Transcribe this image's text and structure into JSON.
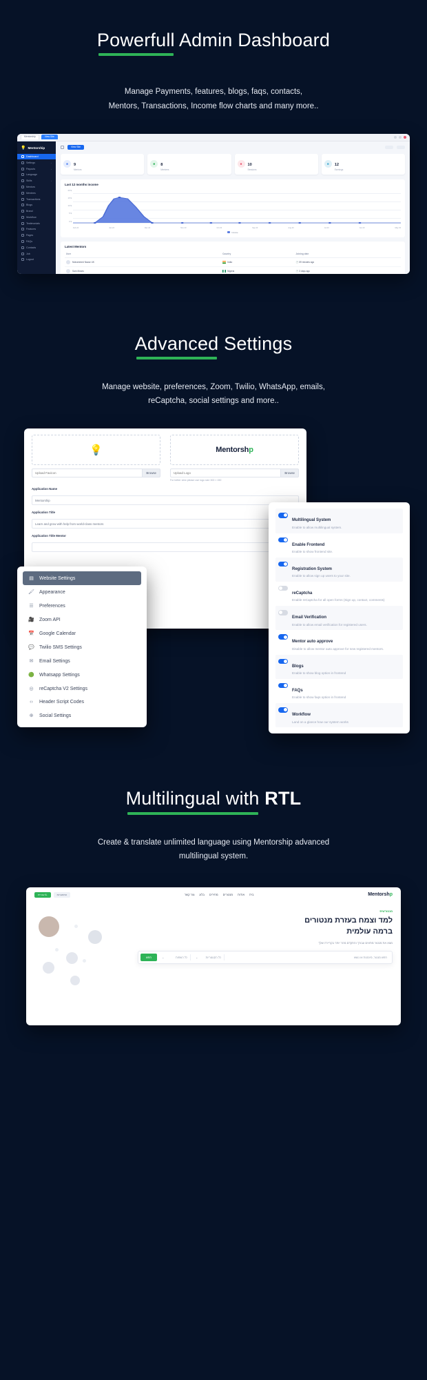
{
  "sections": [
    {
      "heading_underlined": "Powerfull",
      "heading_rest": " Admin Dashboard",
      "sub_line1": "Manage Payments, features, blogs, faqs, contacts,",
      "sub_line2": "Mentors, Transactions, Income flow charts and many more.."
    },
    {
      "heading_underlined": "Advanced",
      "heading_rest": " Settings",
      "sub_line1": "Manage website, preferences, Zoom, Twilio, WhatsApp, emails,",
      "sub_line2": "reCaptcha, social settings and more.."
    },
    {
      "heading_underlined": "Multilingual with",
      "heading_rest": " RTL",
      "sub_line1": "Create & translate unlimited language using Mentorship advanced",
      "sub_line2": "multilingual system."
    }
  ],
  "colors": {
    "background": "#061227",
    "accent_green": "#2eb357",
    "accent_blue": "#1767ef",
    "sidebar": "#0f1a33"
  },
  "dashboard": {
    "browser": {
      "tab_label": "Mentorship",
      "tab_label_active": "View Site"
    },
    "brand": "Mentorship",
    "brand_icon": "bulb-icon",
    "nav": [
      {
        "label": "Dashboard",
        "icon": "grid-icon",
        "active": true,
        "caret": ""
      },
      {
        "label": "Settings",
        "icon": "gear-icon",
        "active": false,
        "caret": "‹"
      },
      {
        "label": "Payouts",
        "icon": "wallet-icon",
        "active": false,
        "caret": "‹"
      },
      {
        "label": "Language",
        "icon": "globe-icon",
        "active": false,
        "caret": ""
      },
      {
        "label": "Skills",
        "icon": "star-icon",
        "active": false,
        "caret": "‹"
      },
      {
        "label": "Mentors",
        "icon": "users-icon",
        "active": false,
        "caret": ""
      },
      {
        "label": "Mentees",
        "icon": "user-icon",
        "active": false,
        "caret": ""
      },
      {
        "label": "Transactions",
        "icon": "exchange-icon",
        "active": false,
        "caret": ""
      },
      {
        "label": "Blogs",
        "icon": "article-icon",
        "active": false,
        "caret": ""
      },
      {
        "label": "Brand",
        "icon": "tag-icon",
        "active": false,
        "caret": ""
      },
      {
        "label": "Workflow",
        "icon": "flow-icon",
        "active": false,
        "caret": ""
      },
      {
        "label": "Testimonials",
        "icon": "quote-icon",
        "active": false,
        "caret": ""
      },
      {
        "label": "Features",
        "icon": "list-icon",
        "active": false,
        "caret": ""
      },
      {
        "label": "Pages",
        "icon": "page-icon",
        "active": false,
        "caret": ""
      },
      {
        "label": "FAQs",
        "icon": "question-icon",
        "active": false,
        "caret": ""
      },
      {
        "label": "Contacts",
        "icon": "mail-icon",
        "active": false,
        "caret": ""
      },
      {
        "label": "Job",
        "icon": "briefcase-icon",
        "active": false,
        "caret": ""
      },
      {
        "label": "Logout",
        "icon": "logout-icon",
        "active": false,
        "caret": ""
      }
    ],
    "view_site_button": "View Site",
    "stats": [
      {
        "number": "9",
        "label": "Mentors",
        "icon": "users-icon",
        "color": "#e6edfd",
        "fg": "#4d7ef0"
      },
      {
        "number": "8",
        "label": "Mentees",
        "icon": "badge-icon",
        "color": "#e3f6ea",
        "fg": "#2eb357"
      },
      {
        "number": "10",
        "label": "Sessions",
        "icon": "calendar-icon",
        "color": "#fde7ea",
        "fg": "#e8576f"
      },
      {
        "number": "12",
        "label": "Earnings",
        "icon": "wallet-icon",
        "color": "#def0f7",
        "fg": "#3fa8cf"
      }
    ],
    "chart": {
      "title": "Last 12 months income",
      "legend": "Income"
    },
    "table": {
      "title": "Latest Mentors",
      "columns": [
        "User",
        "Country",
        "Joining date"
      ],
      "rows": [
        {
          "user": "Muhammed Navaz UK",
          "country": "India",
          "flag": "in",
          "joined": "59 minutes ago"
        },
        {
          "user": "Sam Moses",
          "country": "Nigeria",
          "flag": "ng",
          "joined": "3 days ago"
        }
      ]
    }
  },
  "chart_data": {
    "type": "area",
    "title": "Last 12 months income",
    "xlabel": "",
    "ylabel": "",
    "grid": true,
    "legend_position": "bottom",
    "series": [
      {
        "name": "Income",
        "color": "#5b7ce0",
        "values": [
          0,
          18,
          0,
          0,
          0,
          0,
          0,
          0,
          0,
          0,
          0,
          0
        ]
      }
    ],
    "categories": [
      "Feb 24",
      "Jan 24",
      "Dec 24",
      "Nov 23",
      "Oct 23",
      "Sep 23",
      "Aug 23",
      "Jul 23",
      "Jun 23",
      "May 23",
      "Apr 23",
      "Mar 23"
    ],
    "ytick_labels": [
      "20 $",
      "15 $",
      "10 $",
      "5 $",
      "0 $"
    ],
    "ylim": [
      0,
      20
    ]
  },
  "settings": {
    "favicon": {
      "drop_icon": "bulb-icon",
      "upload_placeholder": "Upload Favicon",
      "browse_label": "Browse"
    },
    "logo": {
      "brand_text": "Mentorsh",
      "brand_text_accent": "p",
      "upload_placeholder": "Upload Logo",
      "browse_label": "Browse",
      "hint": "For better view please use logo size 300 × 150"
    },
    "fields": [
      {
        "label": "Application Name",
        "value": "Mentorship"
      },
      {
        "label": "Application Title",
        "value": "Learn and grow with help from world-class mentors"
      },
      {
        "label": "Application Title Mentor",
        "value": ""
      }
    ],
    "menu": [
      {
        "label": "Website Settings",
        "icon": "layout-icon",
        "active": true
      },
      {
        "label": "Appearance",
        "icon": "brush-icon",
        "active": false
      },
      {
        "label": "Preferences",
        "icon": "sliders-icon",
        "active": false
      },
      {
        "label": "Zoom API",
        "icon": "video-icon",
        "active": false
      },
      {
        "label": "Google Calendar",
        "icon": "calendar-icon",
        "active": false
      },
      {
        "label": "Twilio SMS Settings",
        "icon": "chat-icon",
        "active": false
      },
      {
        "label": "Email Settings",
        "icon": "mail-icon",
        "active": false
      },
      {
        "label": "Whatsapp Settings",
        "icon": "whatsapp-icon",
        "active": false
      },
      {
        "label": "reCaptcha V2 Settings",
        "icon": "shield-icon",
        "active": false
      },
      {
        "label": "Header Script Codes",
        "icon": "code-icon",
        "active": false
      },
      {
        "label": "Social Settings",
        "icon": "share-icon",
        "active": false
      }
    ],
    "toggles": [
      {
        "title": "Multilingual System",
        "desc": "Enable to allow multilingual system.",
        "on": true
      },
      {
        "title": "Enable Frontend",
        "desc": "Enable to show frontend site.",
        "on": true
      },
      {
        "title": "Registration System",
        "desc": "Enable to allow sign up users to your site.",
        "on": true
      },
      {
        "title": "reCaptcha",
        "desc": "Enable reCaptcha for all open forms (Sign up, contact, comments)",
        "on": false
      },
      {
        "title": "Email Verification",
        "desc": "Enable to allow email verification for registered users.",
        "on": false
      },
      {
        "title": "Mentor auto approve",
        "desc": "Disable to allow mentor auto approve for new registered mentors.",
        "on": true
      },
      {
        "title": "Blogs",
        "desc": "Enable to show blog option in frontend",
        "on": true
      },
      {
        "title": "FAQs",
        "desc": "Enable to show faqs option in frontend",
        "on": true
      },
      {
        "title": "Workflow",
        "desc": "Land on a glance how our system works",
        "on": true
      }
    ]
  },
  "rtl_site": {
    "brand": "Mentorsh",
    "brand_accent": "p",
    "nav_links": [
      "בית",
      "אודות",
      "מנטורים",
      "מחירים",
      "בלוג",
      "צור קשר"
    ],
    "pills": [
      {
        "label": "עברית IL",
        "primary": true
      },
      {
        "label": "התחברות",
        "primary": false
      }
    ],
    "eyebrow": "מנטורשיפ",
    "title_line1": "למד וצמח בעזרת מנטורים",
    "title_line2": "ברמה עולמית",
    "paragraph": "מצא את מנטור מתאים עבורך והתקדם מהר יותר בקריירה שלך",
    "search": {
      "keyword_placeholder": "חפש מנטור, מיומנות או נושא",
      "select1": "כל הקטגוריות",
      "select2": "כל השפות",
      "button": "חפש"
    }
  }
}
